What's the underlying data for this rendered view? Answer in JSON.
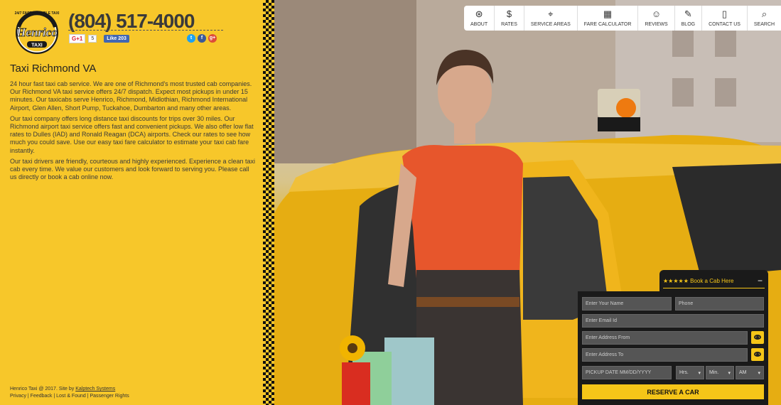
{
  "header": {
    "logo_text": "Henrico",
    "logo_tagline": "24/7 FAST RELIABLE TAXI",
    "logo_sub": "TAXI",
    "phone": "(804) 517-4000"
  },
  "social_buttons": {
    "gplus_label": "G+1",
    "gplus_count": "5",
    "fb_like_label": "Like 203"
  },
  "social_icons": [
    {
      "name": "twitter",
      "glyph": "t",
      "color": "#1da1f2"
    },
    {
      "name": "facebook",
      "glyph": "f",
      "color": "#3b5998"
    },
    {
      "name": "google-plus",
      "glyph": "g+",
      "color": "#dd4b39"
    }
  ],
  "content": {
    "heading": "Taxi Richmond VA",
    "paragraphs": [
      "24 hour fast taxi cab service. We are one of Richmond's most trusted cab companies. Our Richmond VA taxi service offers 24/7 dispatch. Expect most pickups in under 15 minutes. Our taxicabs serve Henrico, Richmond, Midlothian, Richmond International Airport, Glen Allen, Short Pump, Tuckahoe, Dumbarton and many other areas.",
      "Our taxi company offers long distance taxi discounts for trips over 30 miles. Our Richmond airport taxi service offers fast and convenient pickups. We also offer low flat rates to Dulles (IAD) and Ronald Reagan (DCA) airports. Check our rates to see how much you could save. Use our easy taxi fare calculator to estimate your taxi cab fare instantly.",
      "Our taxi drivers are friendly, courteous and highly experienced. Experience a clean taxi cab every time. We value our customers and look forward to serving you. Please call us directly or book a cab online now."
    ]
  },
  "footer": {
    "copyright": "Henrico Taxi @ 2017. Site by ",
    "credit_link": "Kalptech Systems",
    "links": [
      "Privacy",
      "Feedback",
      "Lost & Found",
      "Passenger Rights"
    ]
  },
  "nav": {
    "items": [
      {
        "label": "ABOUT",
        "icon": "steering-wheel-icon",
        "glyph": "⊛"
      },
      {
        "label": "RATES",
        "icon": "dollar-icon",
        "glyph": "$"
      },
      {
        "label": "SERVICE AREAS",
        "icon": "map-pin-icon",
        "glyph": "⌖"
      },
      {
        "label": "FARE CALCULATOR",
        "icon": "calculator-icon",
        "glyph": "▦"
      },
      {
        "label": "REVIEWS",
        "icon": "reviews-icon",
        "glyph": "☺"
      },
      {
        "label": "BLOG",
        "icon": "pencil-icon",
        "glyph": "✎"
      },
      {
        "label": "CONTACT US",
        "icon": "phone-icon",
        "glyph": "▯"
      },
      {
        "label": "SEARCH",
        "icon": "search-icon",
        "glyph": "⌕"
      }
    ]
  },
  "booking": {
    "tab_label": "★★★★★ Book a Cab Here",
    "collapse_glyph": "−",
    "name_placeholder": "Enter Your Name",
    "phone_placeholder": "Phone",
    "email_placeholder": "Enter Email Id",
    "from_placeholder": "Enter Address From",
    "to_placeholder": "Enter Address To",
    "date_placeholder": "PICKUP DATE MM/DD/YYYY",
    "hours_value": "Hrs.",
    "minutes_value": "Min.",
    "ampm_value": "AM",
    "reserve_label": "RESERVE A CAR"
  },
  "colors": {
    "brand_yellow": "#f7c72a",
    "dark": "#1a1a1a",
    "accent": "#f5c518"
  }
}
